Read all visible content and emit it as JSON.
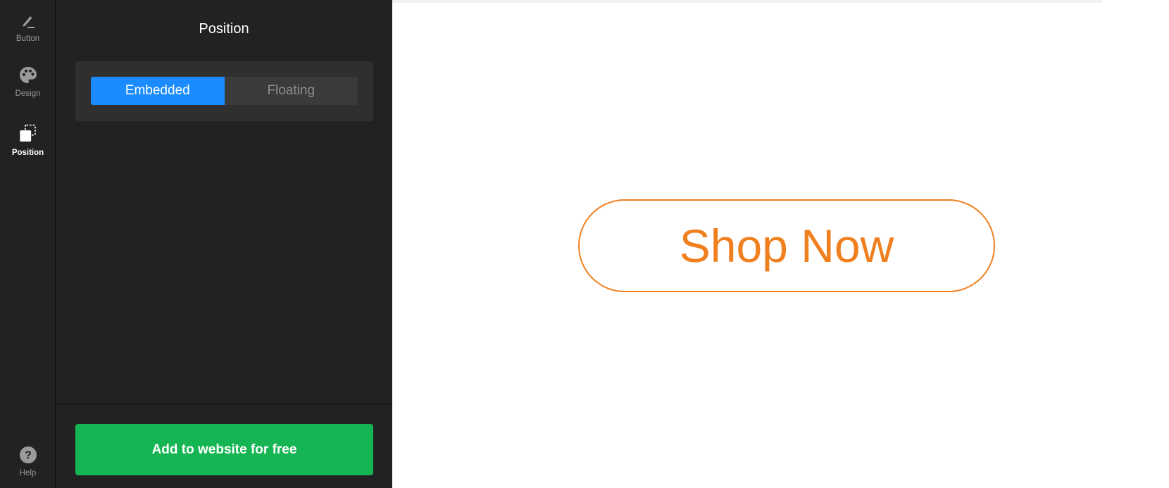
{
  "rail": {
    "items": [
      {
        "label": "Button",
        "icon": "pencil-icon"
      },
      {
        "label": "Design",
        "icon": "palette-icon"
      },
      {
        "label": "Position",
        "icon": "position-icon"
      }
    ],
    "help": {
      "label": "Help",
      "icon": "help-icon"
    }
  },
  "panel": {
    "title": "Position",
    "position_toggle": {
      "options": [
        "Embedded",
        "Floating"
      ],
      "selected": "Embedded"
    },
    "cta_label": "Add to website for free"
  },
  "preview": {
    "button_label": "Shop Now"
  },
  "colors": {
    "sidebar_bg": "#222222",
    "active_segment": "#1a8cff",
    "cta_green": "#16b553",
    "shop_button_orange": "#f0801f"
  }
}
